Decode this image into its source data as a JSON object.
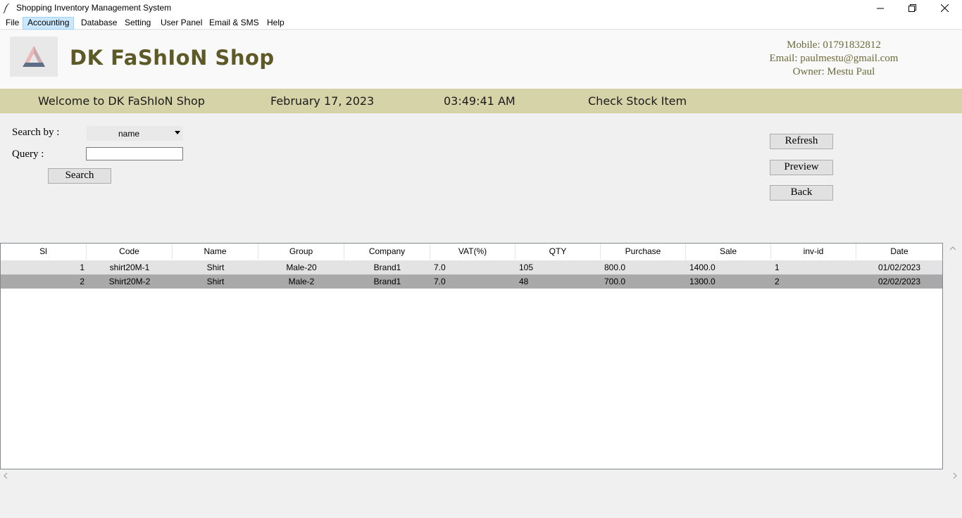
{
  "window": {
    "title": "Shopping Inventory Management System",
    "minimize_glyph": "—",
    "restore_glyph": "❐",
    "close_glyph": "✕"
  },
  "menu": [
    "File",
    "Accounting",
    "Database",
    "Setting",
    "User Panel",
    "Email & SMS",
    "Help"
  ],
  "header": {
    "shop_name": "DK FaShIoN Shop",
    "mobile": "Mobile: 01791832812",
    "email": "Email: paulmestu@gmail.com",
    "owner": "Owner: Mestu Paul",
    "name_color": "#5e5a28"
  },
  "banner": {
    "welcome": "Welcome to DK FaShIoN Shop",
    "date": "February 17, 2023",
    "time": "03:49:41 AM",
    "section": "Check Stock Item",
    "bg_color": "#d6d3a8"
  },
  "search": {
    "search_by_label": "Search by :",
    "search_by_value": "name",
    "query_label": "Query :",
    "query_value": "",
    "search_button": "Search"
  },
  "actions": {
    "refresh": "Refresh",
    "preview": "Preview",
    "back": "Back"
  },
  "table": {
    "columns": [
      "Sl",
      "Code",
      "Name",
      "Group",
      "Company",
      "VAT(%)",
      "QTY",
      "Purchase",
      "Sale",
      "inv-id",
      "Date"
    ],
    "rows": [
      [
        "1",
        "shirt20M-1",
        "Shirt",
        "Male-20",
        "Brand1",
        "7.0",
        "105",
        "800.0",
        "1400.0",
        "1",
        "01/02/2023"
      ],
      [
        "2",
        "Shirt20M-2",
        "Shirt",
        "Male-2",
        "Brand1",
        "7.0",
        "48",
        "700.0",
        "1300.0",
        "2",
        "02/02/2023"
      ]
    ]
  },
  "icons": {
    "app": "feather-icon",
    "logo": "impossible-triangle-logo",
    "scroll_up": "chevron-up-icon",
    "scroll_left": "chevron-left-icon",
    "scroll_right": "chevron-right-icon"
  }
}
